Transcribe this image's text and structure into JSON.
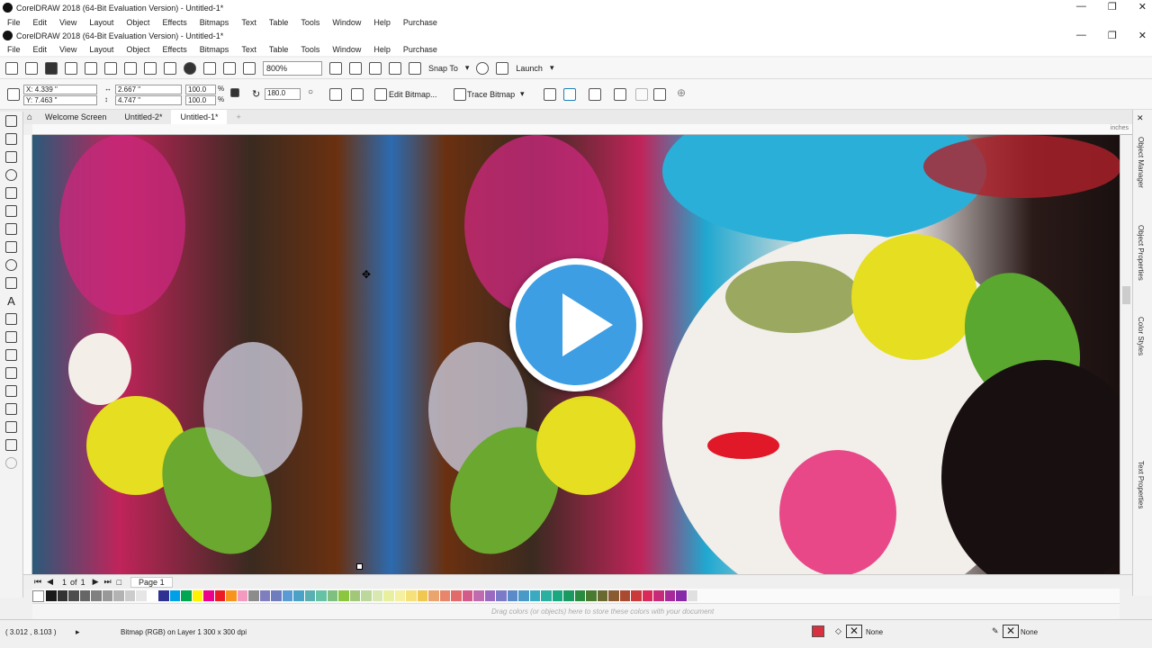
{
  "app": {
    "outer_title": "CorelDRAW 2018 (64-Bit Evaluation Version) - Untitled-1*",
    "inner_title": "CorelDRAW 2018 (64-Bit Evaluation Version) - Untitled-1*"
  },
  "menu": [
    "File",
    "Edit",
    "View",
    "Layout",
    "Object",
    "Effects",
    "Bitmaps",
    "Text",
    "Table",
    "Tools",
    "Window",
    "Help",
    "Purchase"
  ],
  "toolbar": {
    "zoom": "800%",
    "snap_to": "Snap To",
    "launch": "Launch"
  },
  "propbar": {
    "x": "X: 4.339 \"",
    "y": "Y: 7.463 \"",
    "w": "2.667 \"",
    "h": "4.747 \"",
    "sx": "100.0",
    "sy": "100.0",
    "pct": "%",
    "angle": "180.0",
    "edit_bitmap": "Edit Bitmap...",
    "trace_bitmap": "Trace Bitmap"
  },
  "tabs": [
    "Welcome Screen",
    "Untitled-2*",
    "Untitled-1*"
  ],
  "ruler": {
    "units": "inches"
  },
  "dockers": [
    "Object Manager",
    "Object Properties",
    "Color Styles",
    "Text Properties"
  ],
  "pagebar": {
    "current": "1",
    "of": "of",
    "total": "1",
    "page_tab": "Page 1"
  },
  "palette_hint": "Drag colors (or objects) here to store these colors with your document",
  "palette_colors": [
    "#1a1a1a",
    "#333",
    "#4d4d4d",
    "#666",
    "#808080",
    "#999",
    "#b3b3b3",
    "#ccc",
    "#e6e6e6",
    "#fff",
    "#2e3192",
    "#00a0e9",
    "#00a651",
    "#fff200",
    "#ec008c",
    "#ed1c24",
    "#f7941d",
    "#f49ac1",
    "#8c8c8c",
    "#7f7fbf",
    "#6f7dbf",
    "#5a9bd5",
    "#4aa3c7",
    "#5ab0b0",
    "#66c2a5",
    "#7fbf7f",
    "#8cc63f",
    "#a0c878",
    "#bcd89c",
    "#d9e8b0",
    "#e8f0a0",
    "#f5f0a0",
    "#f5e07a",
    "#f0c850",
    "#eaa56f",
    "#e8856a",
    "#e26a6a",
    "#d45a8a",
    "#c06ab0",
    "#9a6ac0",
    "#7a7ac8",
    "#5a8ac8",
    "#4a9ac8",
    "#3aaac0",
    "#2ab0a0",
    "#1aa880",
    "#1a9a60",
    "#2a8a40",
    "#4a7a30",
    "#6a6a30",
    "#8a5a30",
    "#aa4a30",
    "#ca3a3a",
    "#da2a5a",
    "#c82a7a",
    "#a82a9a",
    "#882aa8",
    "#e0e0e0"
  ],
  "status": {
    "coords": "( 3.012 , 8.103 )",
    "info": "Bitmap (RGB) on Layer 1 300 x 300 dpi",
    "fill": "None",
    "outline": "None"
  }
}
